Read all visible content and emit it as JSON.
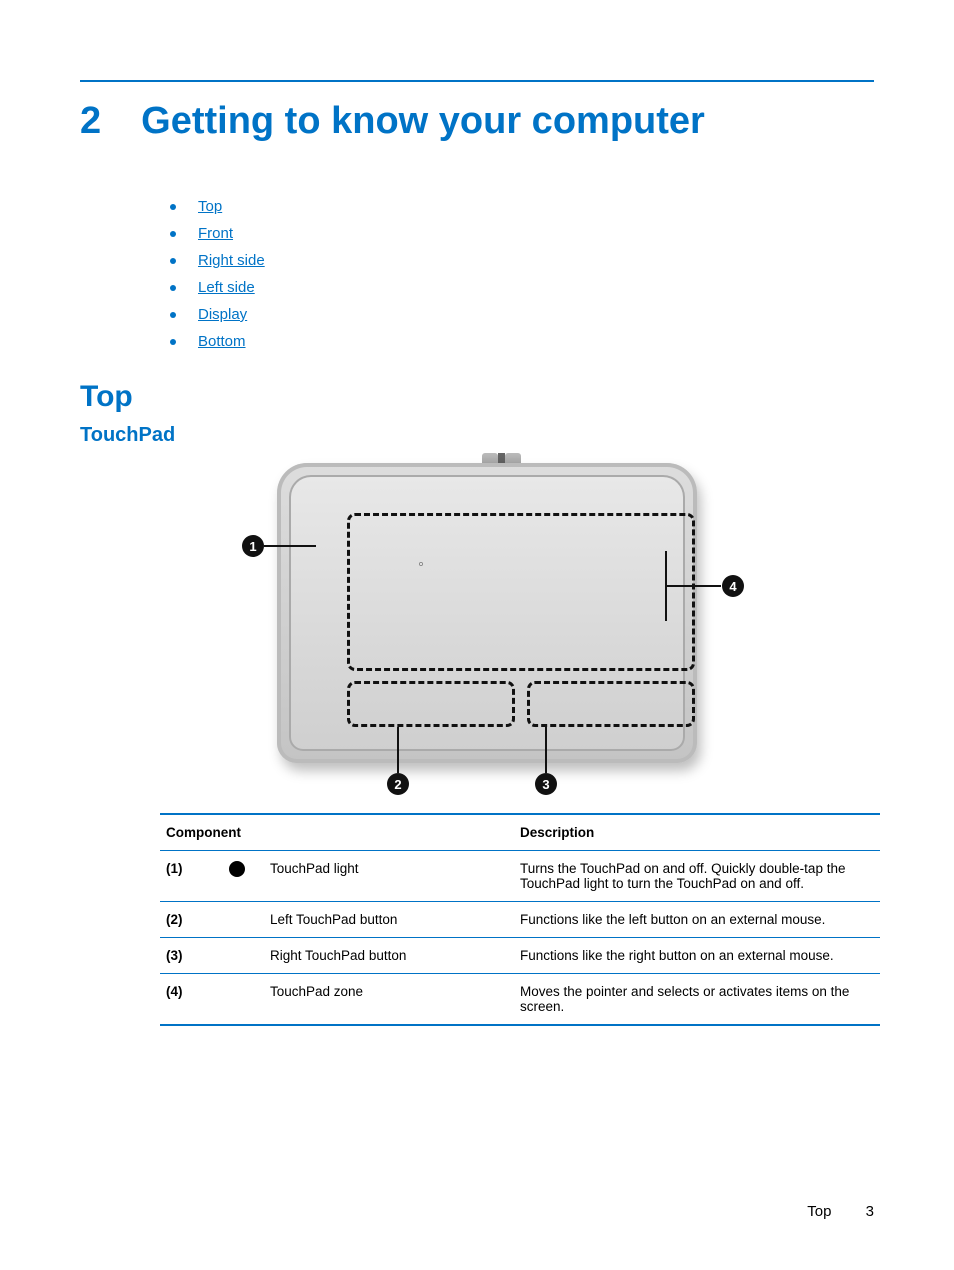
{
  "chapter": {
    "number": "2",
    "title": "Getting to know your computer"
  },
  "toc": [
    {
      "label": "Top"
    },
    {
      "label": "Front"
    },
    {
      "label": "Right side"
    },
    {
      "label": "Left side"
    },
    {
      "label": "Display"
    },
    {
      "label": "Bottom"
    }
  ],
  "section_h2": "Top",
  "section_h3": "TouchPad",
  "callouts": {
    "c1": "1",
    "c2": "2",
    "c3": "3",
    "c4": "4"
  },
  "table": {
    "headers": {
      "component": "Component",
      "description": "Description"
    },
    "rows": [
      {
        "num": "(1)",
        "has_icon": true,
        "name": "TouchPad light",
        "desc": "Turns the TouchPad on and off. Quickly double-tap the TouchPad light to turn the TouchPad on and off."
      },
      {
        "num": "(2)",
        "has_icon": false,
        "name": "Left TouchPad button",
        "desc": "Functions like the left button on an external mouse."
      },
      {
        "num": "(3)",
        "has_icon": false,
        "name": "Right TouchPad button",
        "desc": "Functions like the right button on an external mouse."
      },
      {
        "num": "(4)",
        "has_icon": false,
        "name": "TouchPad zone",
        "desc": "Moves the pointer and selects or activates items on the screen."
      }
    ]
  },
  "footer": {
    "section": "Top",
    "page": "3"
  }
}
